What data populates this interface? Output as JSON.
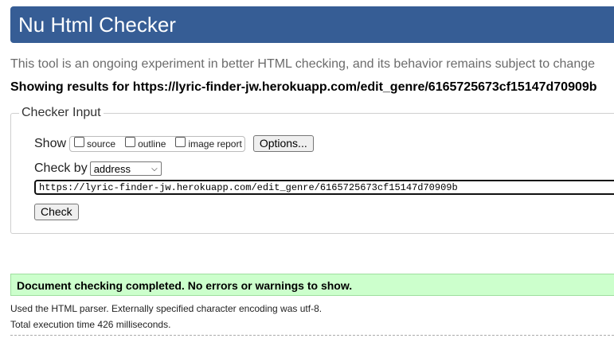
{
  "header": {
    "title": "Nu Html Checker"
  },
  "intro": "This tool is an ongoing experiment in better HTML checking, and its behavior remains subject to change",
  "showing": "Showing results for https://lyric-finder-jw.herokuapp.com/edit_genre/6165725673cf15147d70909b",
  "checker_input": {
    "legend": "Checker Input",
    "show_label": "Show",
    "options": [
      {
        "label": "source",
        "checked": false
      },
      {
        "label": "outline",
        "checked": false
      },
      {
        "label": "image report",
        "checked": false
      }
    ],
    "options_button": "Options...",
    "check_by_label": "Check by",
    "check_by_value": "address",
    "url_value": "https://lyric-finder-jw.herokuapp.com/edit_genre/6165725673cf15147d70909b",
    "check_button": "Check"
  },
  "result": {
    "message": "Document checking completed. No errors or warnings to show.",
    "parser_info": "Used the HTML parser. Externally specified character encoding was utf-8.",
    "execution_time": "Total execution time 426 milliseconds."
  }
}
